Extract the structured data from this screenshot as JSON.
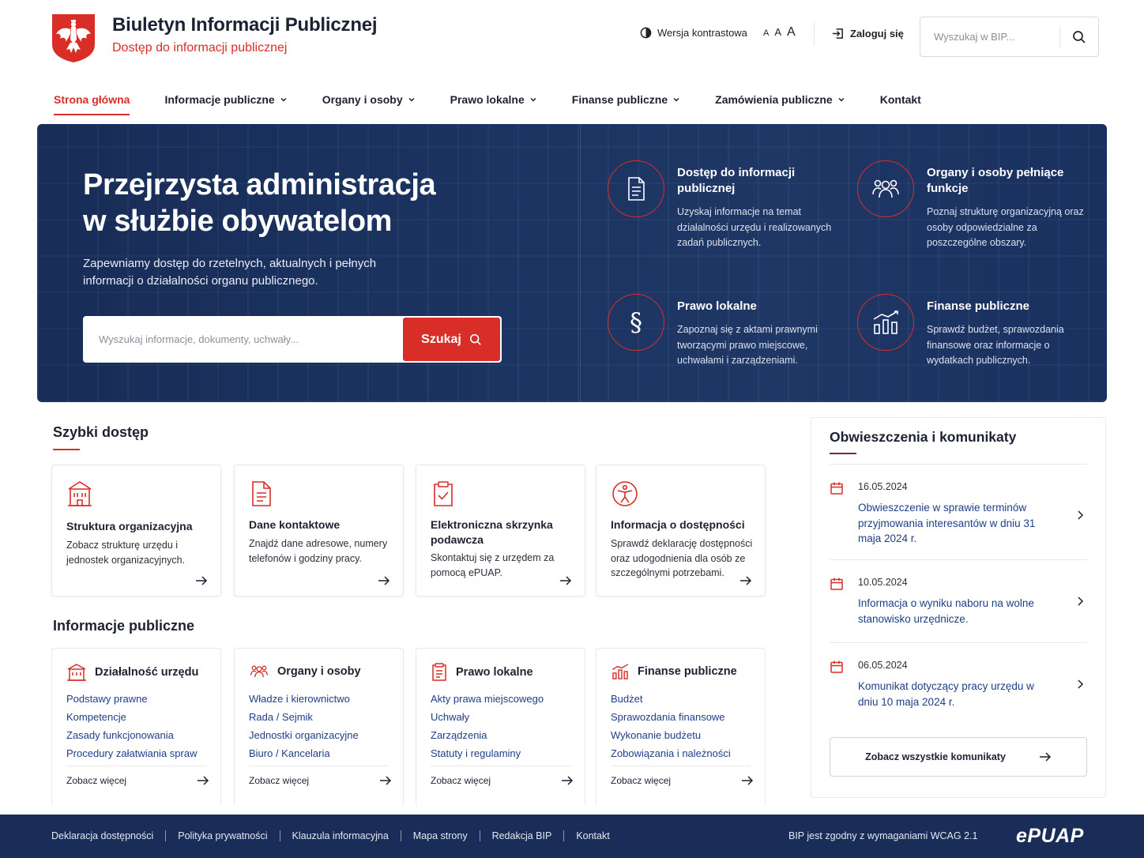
{
  "header": {
    "title": "Biuletyn Informacji Publicznej",
    "subtitle": "Dostęp do informacji publicznej",
    "contrast_label": "Wersja kontrastowa",
    "font_sizes": [
      "A",
      "A",
      "A"
    ],
    "login_label": "Zaloguj się",
    "search_placeholder": "Wyszukaj w BIP..."
  },
  "nav": {
    "items": [
      {
        "label": "Strona główna",
        "active": true
      },
      {
        "label": "Informacje publiczne",
        "dropdown": true
      },
      {
        "label": "Organy i osoby",
        "dropdown": true
      },
      {
        "label": "Prawo lokalne",
        "dropdown": true
      },
      {
        "label": "Finanse publiczne",
        "dropdown": true
      },
      {
        "label": "Zamówienia publiczne",
        "dropdown": true
      },
      {
        "label": "Kontakt"
      }
    ]
  },
  "hero": {
    "title_line1": "Przejrzysta administracja",
    "title_line2": "w służbie obywatelom",
    "description": "Zapewniamy dostęp do rzetelnych, aktualnych i pełnych informacji o działalności organu publicznego.",
    "search_placeholder": "Wyszukaj informacje, dokumenty, uchwały...",
    "search_button": "Szukaj",
    "features": [
      {
        "icon": "document-icon",
        "title": "Dostęp do informacji publicznej",
        "desc": "Uzyskaj informacje na temat działalności urzędu i realizowanych zadań publicznych."
      },
      {
        "icon": "people-icon",
        "title": "Organy i osoby pełniące funkcje",
        "desc": "Poznaj strukturę organizacyjną oraz osoby odpowiedzialne za poszczególne obszary."
      },
      {
        "icon": "paragraph-icon",
        "title": "Prawo lokalne",
        "desc": "Zapoznaj się z aktami prawnymi tworzącymi prawo miejscowe, uchwałami i zarządzeniami."
      },
      {
        "icon": "bar-chart-icon",
        "title": "Finanse publiczne",
        "desc": "Sprawdź budżet, sprawozdania finansowe oraz informacje o wydatkach publicznych."
      }
    ]
  },
  "quick_access": {
    "title": "Szybki dostęp",
    "cards": [
      {
        "icon": "building-icon",
        "title": "Struktura organizacyjna",
        "desc": "Zobacz strukturę urzędu i jednostek organizacyjnych."
      },
      {
        "icon": "document-icon",
        "title": "Dane kontaktowe",
        "desc": "Znajdź dane adresowe, numery telefonów i godziny pracy."
      },
      {
        "icon": "clipboard-check-icon",
        "title": "Elektroniczna skrzynka podawcza",
        "desc": "Skontaktuj się z urzędem za pomocą ePUAP."
      },
      {
        "icon": "accessibility-icon",
        "title": "Informacja o dostępności",
        "desc": "Sprawdź deklarację dostępności oraz udogodnienia dla osób ze szczególnymi potrzebami."
      }
    ]
  },
  "public_info": {
    "title": "Informacje publiczne",
    "more_label": "Zobacz więcej",
    "cards": [
      {
        "icon": "office-icon",
        "title": "Działalność urzędu",
        "links": [
          "Podstawy prawne",
          "Kompetencje",
          "Zasady funkcjonowania",
          "Procedury załatwiania spraw"
        ]
      },
      {
        "icon": "people-icon",
        "title": "Organy i osoby",
        "links": [
          "Władze i kierownictwo",
          "Rada / Sejmik",
          "Jednostki organizacyjne",
          "Biuro / Kancelaria"
        ]
      },
      {
        "icon": "clipboard-icon",
        "title": "Prawo lokalne",
        "links": [
          "Akty prawa miejscowego",
          "Uchwały",
          "Zarządzenia",
          "Statuty i regulaminy"
        ]
      },
      {
        "icon": "bar-chart-icon",
        "title": "Finanse publiczne",
        "links": [
          "Budżet",
          "Sprawozdania finansowe",
          "Wykonanie budżetu",
          "Zobowiązania i należności"
        ]
      }
    ]
  },
  "announcements": {
    "title": "Obwieszczenia i komunikaty",
    "items": [
      {
        "date": "16.05.2024",
        "text": "Obwieszczenie w sprawie terminów przyjmowania interesantów w dniu 31 maja 2024 r."
      },
      {
        "date": "10.05.2024",
        "text": "Informacja o wyniku naboru na wolne stanowisko urzędnicze."
      },
      {
        "date": "06.05.2024",
        "text": "Komunikat dotyczący pracy urzędu w dniu 10 maja 2024 r."
      }
    ],
    "all_button": "Zobacz wszystkie komunikaty"
  },
  "footer": {
    "links": [
      "Deklaracja dostępności",
      "Polityka prywatności",
      "Klauzula informacyjna",
      "Mapa strony",
      "Redakcja BIP",
      "Kontakt"
    ],
    "wcag": "BIP jest zgodny z wymaganiami WCAG 2.1",
    "logo_text": "ePUAP"
  },
  "colors": {
    "accent": "#d92d27",
    "navy": "#1a2d59",
    "link": "#1f3f86"
  }
}
